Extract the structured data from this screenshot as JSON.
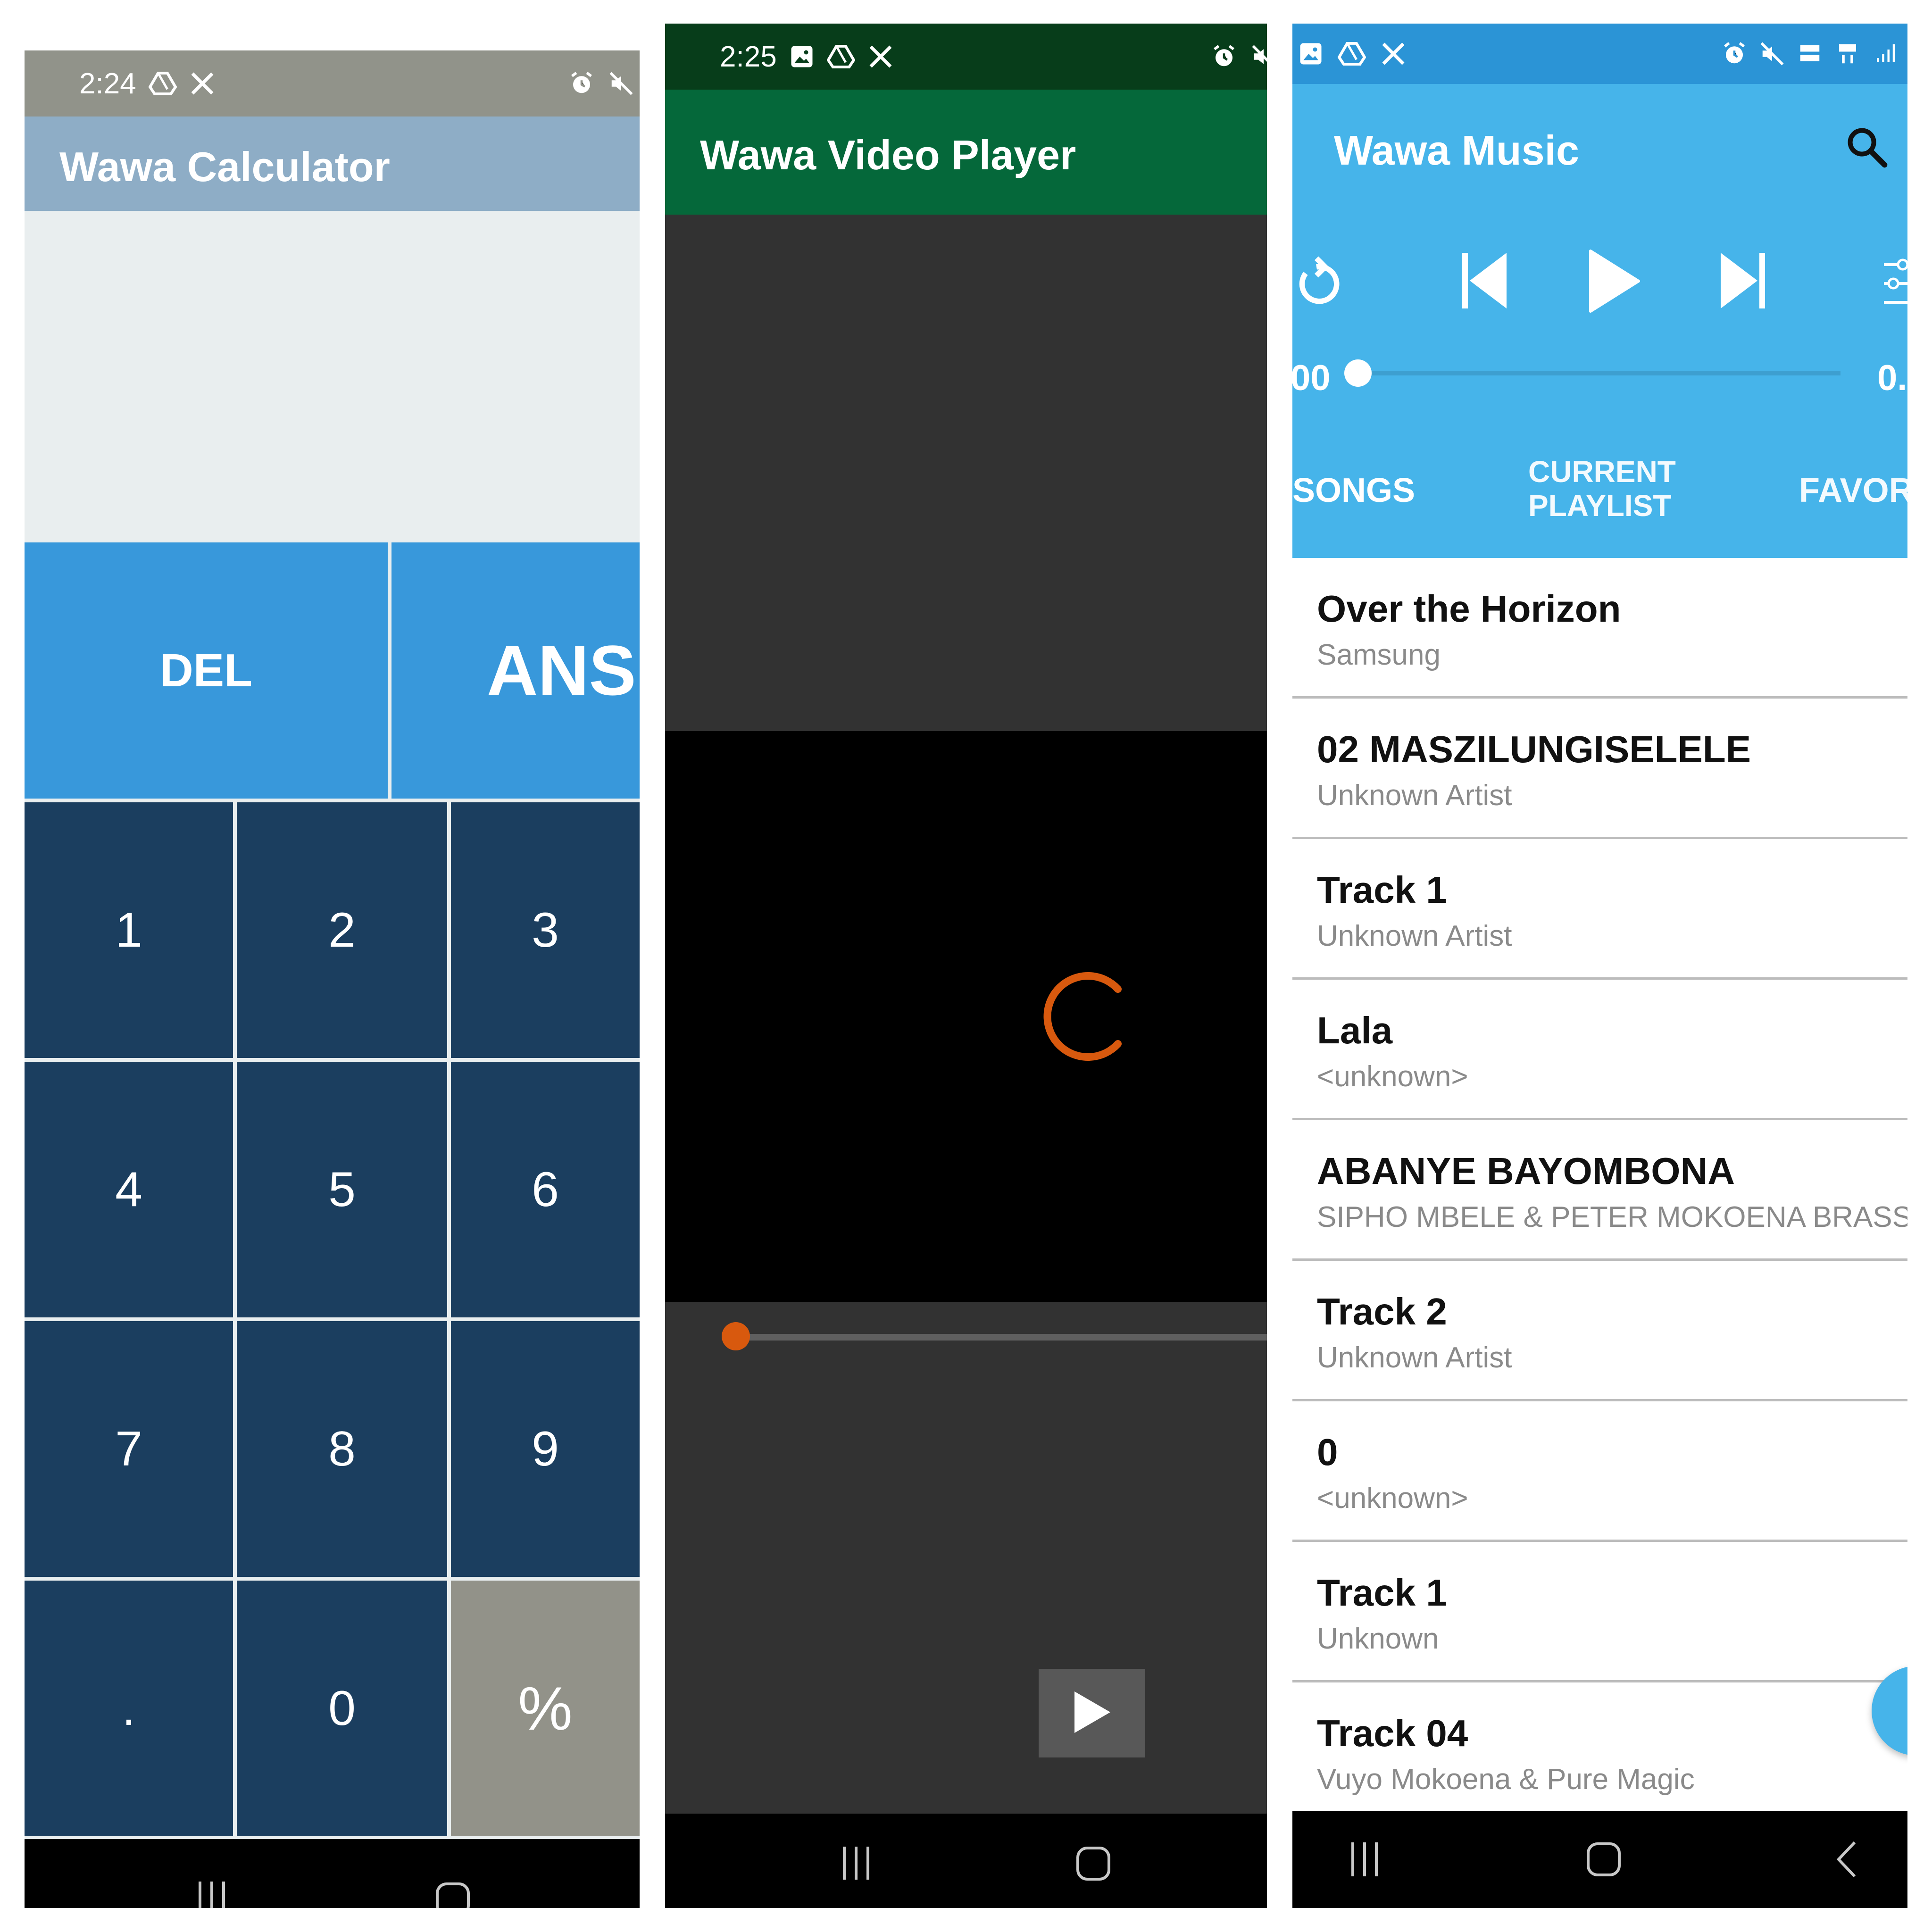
{
  "calculator": {
    "status": {
      "time": "2:24"
    },
    "app_title": "Wawa Calculator",
    "top_keys": {
      "del": "DEL",
      "ans": "ANS"
    },
    "keys": [
      {
        "label": "1"
      },
      {
        "label": "2"
      },
      {
        "label": "3"
      },
      {
        "label": "4"
      },
      {
        "label": "5"
      },
      {
        "label": "6"
      },
      {
        "label": "7"
      },
      {
        "label": "8"
      },
      {
        "label": "9"
      },
      {
        "label": "."
      },
      {
        "label": "0"
      },
      {
        "label": "%"
      }
    ],
    "colors": {
      "appbar": "#8eadc6",
      "top_keys": "#3898db",
      "num_keys": "#1b3e5f",
      "percent_key": "#929289"
    }
  },
  "video": {
    "status": {
      "time": "2:25"
    },
    "app_title": "Wawa Video Player",
    "progress": 0,
    "colors": {
      "appbar": "#05683a",
      "accent": "#d8590e"
    }
  },
  "music": {
    "app_title": "Wawa Music",
    "time_left": "00",
    "time_right": "0.",
    "progress": 0,
    "tabs": [
      "SONGS",
      "CURRENT PLAYLIST",
      "FAVORITES"
    ],
    "songs": [
      {
        "title": "Over the Horizon",
        "artist": "Samsung"
      },
      {
        "title": "02 MASZILUNGISELELE",
        "artist": "Unknown Artist"
      },
      {
        "title": "Track 1",
        "artist": "Unknown Artist"
      },
      {
        "title": "Lala",
        "artist": "<unknown>"
      },
      {
        "title": "ABANYE BAYOMBONA",
        "artist": "SIPHO MBELE & PETER MOKOENA BRASS BA"
      },
      {
        "title": "Track 2",
        "artist": "Unknown Artist"
      },
      {
        "title": "0",
        "artist": "<unknown>"
      },
      {
        "title": "Track 1",
        "artist": "Unknown"
      },
      {
        "title": "Track 04",
        "artist": "Vuyo Mokoena & Pure Magic"
      }
    ],
    "colors": {
      "header": "#46b4ea",
      "status": "#2b94d6"
    }
  },
  "icons": [
    "alarm-icon",
    "mute-icon",
    "drive-icon",
    "x-icon",
    "image-icon",
    "search-icon",
    "repeat-icon",
    "previous-icon",
    "play-icon",
    "next-icon",
    "equalizer-icon",
    "recents-icon",
    "home-icon",
    "back-icon"
  ]
}
